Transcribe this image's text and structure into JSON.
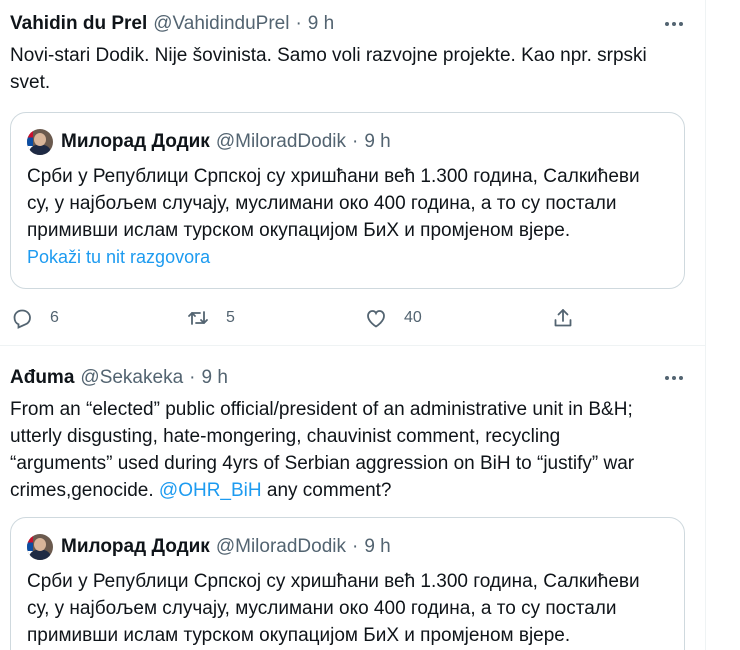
{
  "tweets": [
    {
      "author_name": "Vahidin du Prel",
      "handle": "@VahidinduPrel",
      "separator": "·",
      "time": "9 h",
      "text_lines": [
        "Novi-stari Dodik. Nije šovinista. Samo voli razvojne projekte. Kao npr. srpski",
        "svet."
      ],
      "quote": {
        "author_name": "Милорад Додик",
        "handle": "@MiloradDodik",
        "separator": "·",
        "time": "9 h",
        "text_lines": [
          "Срби у Републици Српској су хришћани већ 1.300 година, Салкићеви",
          "су, у најбољем случају, муслимани око 400 година, а то су постали",
          "примивши ислам турском окупацијом БиХ и промјеном вјере."
        ],
        "thread_link": "Pokaži tu nit razgovora"
      },
      "stats": {
        "replies": "6",
        "retweets": "5",
        "likes": "40"
      }
    },
    {
      "author_name": "Ađuma",
      "handle": "@Sekakeka",
      "separator": "·",
      "time": "9 h",
      "text_lines": [
        "From an “elected” public official/president of an administrative unit in B&H;",
        "utterly disgusting, hate-mongering, chauvinist comment, recycling",
        "“arguments” used during 4yrs of Serbian aggression on BiH to “justify” war"
      ],
      "last_line_prefix": "crimes,genocide. ",
      "mention": "@OHR_BiH",
      "last_line_suffix": " any comment?",
      "quote": {
        "author_name": "Милорад Додик",
        "handle": "@MiloradDodik",
        "separator": "·",
        "time": "9 h",
        "text_lines": [
          "Срби у Републици Српској су хришћани већ 1.300 година, Салкићеви",
          "су, у најбољем случају, муслимани око 400 година, а то су постали",
          "примивши ислам турском окупацијом БиХ и промјеном вјере."
        ]
      }
    }
  ],
  "icons": {
    "reply": "reply-icon",
    "retweet": "retweet-icon",
    "like": "like-icon",
    "share": "share-icon",
    "more": "more-icon"
  },
  "colors": {
    "text": "#0f1419",
    "secondary": "#536471",
    "link": "#1d9bf0",
    "border": "#cfd9de"
  }
}
